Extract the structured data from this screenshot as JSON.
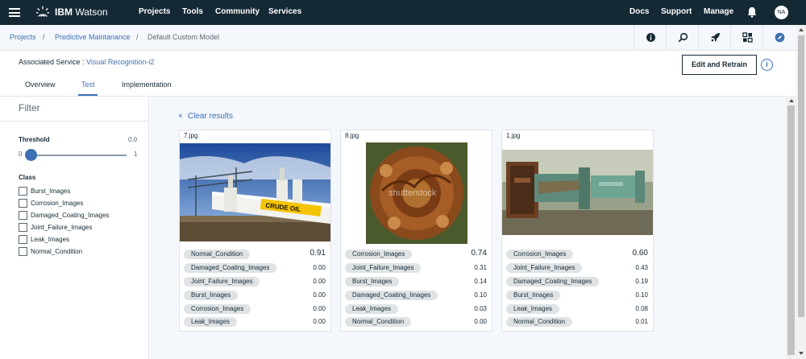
{
  "topbar": {
    "brand_bold": "IBM",
    "brand_rest": " Watson",
    "nav_left": [
      "Projects",
      "Tools",
      "Community",
      "Services"
    ],
    "nav_right": [
      "Docs",
      "Support",
      "Manage"
    ],
    "avatar": "NA"
  },
  "breadcrumb": {
    "items": [
      "Projects",
      "Predictive Maintanance",
      "Default Custom Model"
    ],
    "separator": "/"
  },
  "service": {
    "label": "Associated Service : ",
    "name": "Visual Recognition-i2"
  },
  "actions": {
    "retrain": "Edit and Retrain",
    "info": "i"
  },
  "tabs": [
    "Overview",
    "Test",
    "Implementation"
  ],
  "filter": {
    "title": "Filter",
    "threshold_label": "Threshold",
    "threshold_value": "0.0",
    "slider_min": "0",
    "slider_max": "1",
    "class_label": "Class",
    "classes": [
      "Burst_Images",
      "Corrosion_Images",
      "Damaged_Coating_Images",
      "Joint_Failure_Images",
      "Leak_Images",
      "Normal_Condition"
    ]
  },
  "results": {
    "clear": "Clear results",
    "clear_icon": "×",
    "cards": [
      {
        "name": "7.jpg",
        "scores": [
          {
            "label": "Normal_Condition",
            "score": "0.91"
          },
          {
            "label": "Damaged_Coating_Images",
            "score": "0.00"
          },
          {
            "label": "Joint_Failure_Images",
            "score": "0.00"
          },
          {
            "label": "Burst_Images",
            "score": "0.00"
          },
          {
            "label": "Corrosion_Images",
            "score": "0.00"
          },
          {
            "label": "Leak_Images",
            "score": "0.00"
          }
        ]
      },
      {
        "name": "8.jpg",
        "scores": [
          {
            "label": "Corrosion_Images",
            "score": "0.74"
          },
          {
            "label": "Joint_Failure_Images",
            "score": "0.31"
          },
          {
            "label": "Burst_Images",
            "score": "0.14"
          },
          {
            "label": "Damaged_Coating_Images",
            "score": "0.10"
          },
          {
            "label": "Leak_Images",
            "score": "0.03"
          },
          {
            "label": "Normal_Condition",
            "score": "0.00"
          }
        ]
      },
      {
        "name": "1.jpg",
        "scores": [
          {
            "label": "Corrosion_Images",
            "score": "0.60"
          },
          {
            "label": "Joint_Failure_Images",
            "score": "0.43"
          },
          {
            "label": "Damaged_Coating_Images",
            "score": "0.19"
          },
          {
            "label": "Burst_Images",
            "score": "0.10"
          },
          {
            "label": "Leak_Images",
            "score": "0.08"
          },
          {
            "label": "Normal_Condition",
            "score": "0.01"
          }
        ]
      }
    ]
  },
  "image_text": {
    "pipeline_sign": "CRUDE OIL",
    "watermark": "shutterstock"
  },
  "colors": {
    "topbar": "#152935",
    "accent": "#3d70b2",
    "pill": "#dfe3e6",
    "content_bg": "#f4f7fb"
  }
}
